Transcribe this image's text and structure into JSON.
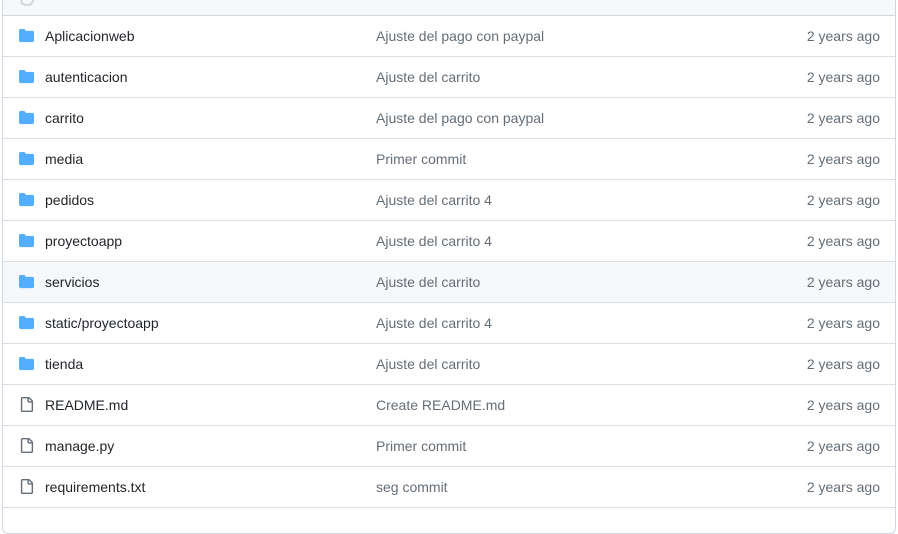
{
  "files": [
    {
      "name": "Aplicacionweb",
      "type": "folder",
      "commit_message": "Ajuste del pago con paypal",
      "age": "2 years ago"
    },
    {
      "name": "autenticacion",
      "type": "folder",
      "commit_message": "Ajuste del carrito",
      "age": "2 years ago"
    },
    {
      "name": "carrito",
      "type": "folder",
      "commit_message": "Ajuste del pago con paypal",
      "age": "2 years ago"
    },
    {
      "name": "media",
      "type": "folder",
      "commit_message": "Primer commit",
      "age": "2 years ago"
    },
    {
      "name": "pedidos",
      "type": "folder",
      "commit_message": "Ajuste del carrito 4",
      "age": "2 years ago"
    },
    {
      "name": "proyectoapp",
      "type": "folder",
      "commit_message": "Ajuste del carrito 4",
      "age": "2 years ago"
    },
    {
      "name": "servicios",
      "type": "folder",
      "commit_message": "Ajuste del carrito",
      "age": "2 years ago"
    },
    {
      "name": "static/proyectoapp",
      "type": "folder",
      "commit_message": "Ajuste del carrito 4",
      "age": "2 years ago"
    },
    {
      "name": "tienda",
      "type": "folder",
      "commit_message": "Ajuste del carrito",
      "age": "2 years ago"
    },
    {
      "name": "README.md",
      "type": "file",
      "commit_message": "Create README.md",
      "age": "2 years ago"
    },
    {
      "name": "manage.py",
      "type": "file",
      "commit_message": "Primer commit",
      "age": "2 years ago"
    },
    {
      "name": "requirements.txt",
      "type": "file",
      "commit_message": "seg commit",
      "age": "2 years ago"
    }
  ],
  "hovered_row": "servicios",
  "colors": {
    "folder_icon": "#54aeff",
    "file_icon": "#656d76",
    "border": "#d0d7de",
    "hover_bg": "#f6f8fa",
    "text": "#1f2328",
    "muted": "#656d76"
  },
  "icons": {
    "folder": "folder-icon",
    "file": "file-icon"
  }
}
